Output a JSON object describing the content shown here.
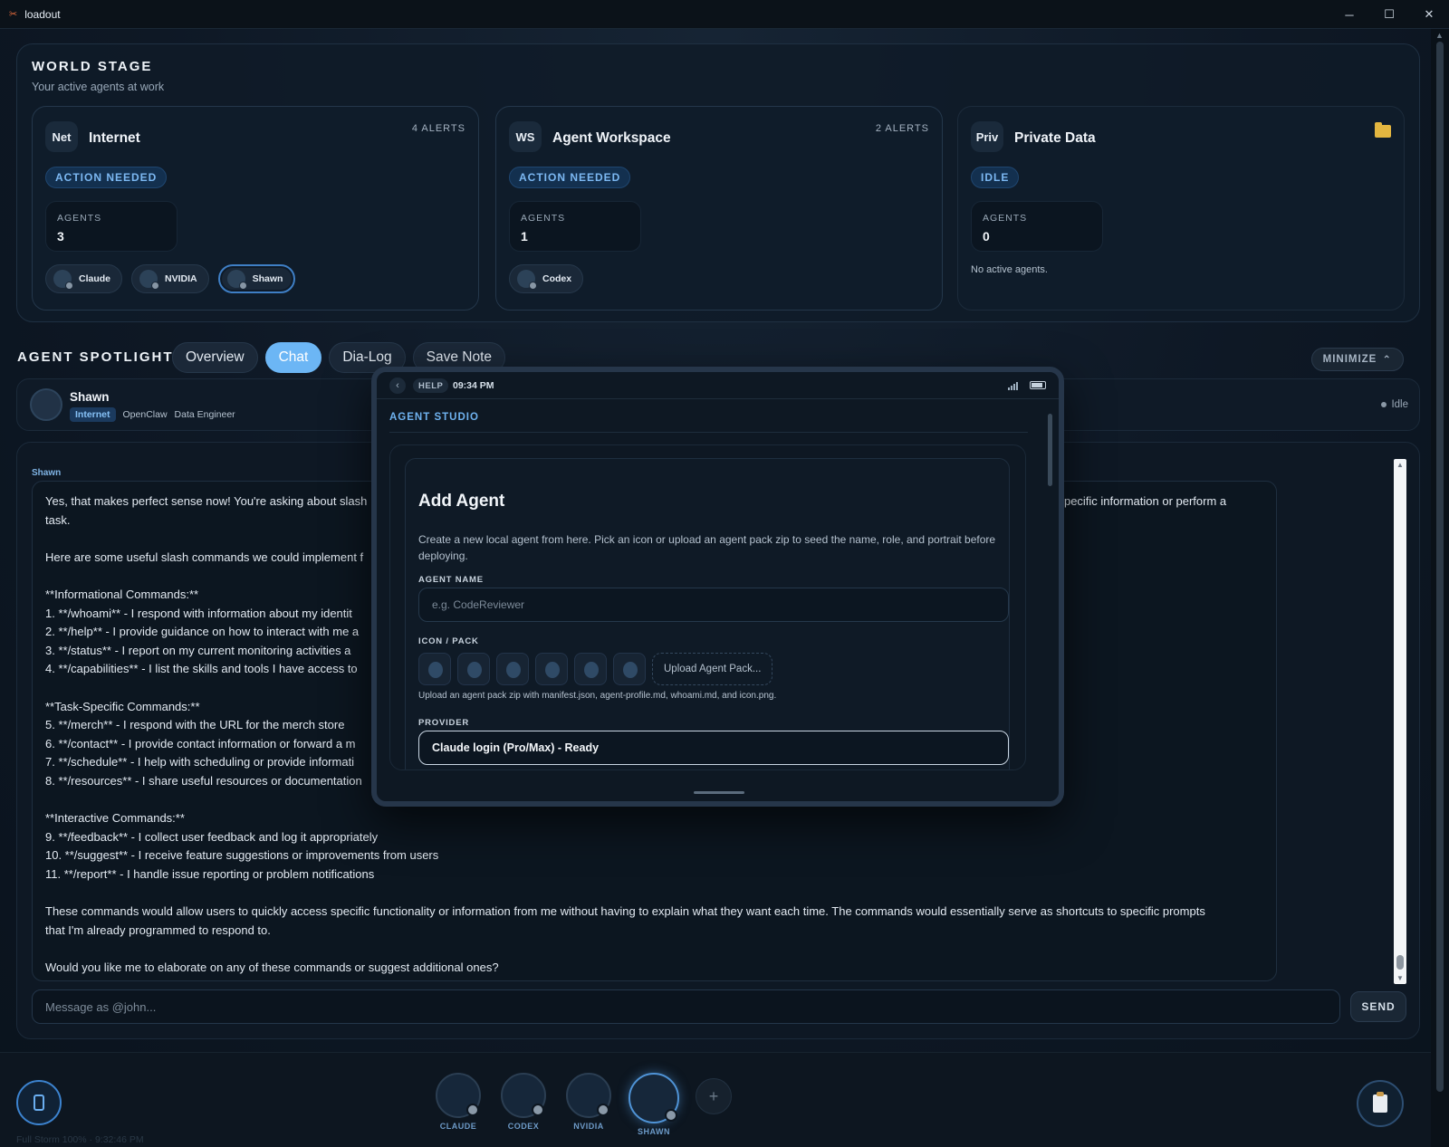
{
  "window": {
    "title": "loadout",
    "app_icon": "✂"
  },
  "world_stage": {
    "title": "WORLD STAGE",
    "subtitle": "Your active agents at work",
    "zones": [
      {
        "badge": "Net",
        "name": "Internet",
        "alerts": "4 ALERTS",
        "status": "ACTION NEEDED",
        "agents_label": "AGENTS",
        "agents_count": "3",
        "agents": [
          "Claude",
          "NVIDIA",
          "Shawn"
        ]
      },
      {
        "badge": "WS",
        "name": "Agent Workspace",
        "alerts": "2 ALERTS",
        "status": "ACTION NEEDED",
        "agents_label": "AGENTS",
        "agents_count": "1",
        "agents": [
          "Codex"
        ]
      },
      {
        "badge": "Priv",
        "name": "Private Data",
        "status": "IDLE",
        "agents_label": "AGENTS",
        "agents_count": "0",
        "empty_text": "No active agents."
      }
    ]
  },
  "spotlight": {
    "title": "AGENT SPOTLIGHT",
    "tabs": [
      "Overview",
      "Chat",
      "Dia-Log",
      "Save Note"
    ],
    "active_tab": "Chat",
    "minimize_label": "MINIMIZE",
    "agent": {
      "name": "Shawn",
      "zone_tag": "Internet",
      "framework": "OpenClaw",
      "role": "Data Engineer",
      "status": "Idle"
    }
  },
  "chat": {
    "author": "Shawn",
    "lines": [
      "Yes, that makes perfect sense now! You're asking about slash",
      "task.",
      "",
      "Here are some useful slash commands we could implement f",
      "",
      "**Informational Commands:**",
      "1. **/whoami** - I respond with information about my identit",
      "2. **/help** - I provide guidance on how to interact with me a",
      "3. **/status** - I report on my current monitoring activities a",
      "4. **/capabilities** - I list the skills and tools I have access to",
      "",
      "**Task-Specific Commands:**",
      "5. **/merch** - I respond with the URL for the merch store",
      "6. **/contact** - I provide contact information or forward a m",
      "7. **/schedule** - I help with scheduling or provide informati",
      "8. **/resources** - I share useful resources or documentation",
      "",
      "**Interactive Commands:**",
      "9. **/feedback** - I collect user feedback and log it appropriately",
      "10. **/suggest** - I receive feature suggestions or improvements from users",
      "11. **/report** - I handle issue reporting or problem notifications",
      "",
      "These commands would allow users to quickly access specific functionality or information from me without having to explain what they want each time. The commands would essentially serve as shortcuts to specific prompts",
      "that I'm already programmed to respond to.",
      "",
      "Would you like me to elaborate on any of these commands or suggest additional ones?"
    ],
    "line1_tail": "vide specific information or perform a",
    "input_placeholder": "Message as @john...",
    "send_label": "SEND"
  },
  "dock": {
    "agents": [
      {
        "label": "CLAUDE",
        "active": false
      },
      {
        "label": "CODEX",
        "active": false
      },
      {
        "label": "NVIDIA",
        "active": false
      },
      {
        "label": "SHAWN",
        "active": true
      }
    ],
    "add_label": "+",
    "footer_status": "Full Storm 100% · 9:32:46 PM"
  },
  "phone": {
    "help_label": "HELP",
    "time": "09:34 PM",
    "studio_title": "AGENT STUDIO",
    "card": {
      "title": "Add Agent",
      "description": "Create a new local agent from here. Pick an icon or upload an agent pack zip to seed the name, role, and portrait before deploying.",
      "name_label": "AGENT NAME",
      "name_placeholder": "e.g. CodeReviewer",
      "icon_label": "ICON / PACK",
      "upload_label": "Upload Agent Pack...",
      "upload_hint": "Upload an agent pack zip with manifest.json, agent-profile.md, whoami.md, and icon.png.",
      "provider_label": "PROVIDER",
      "provider_value": "Claude login (Pro/Max) - Ready"
    }
  },
  "colors": {
    "accent": "#6cb6f5",
    "status_blue": "#7cb8f2",
    "background": "#0d1722"
  }
}
